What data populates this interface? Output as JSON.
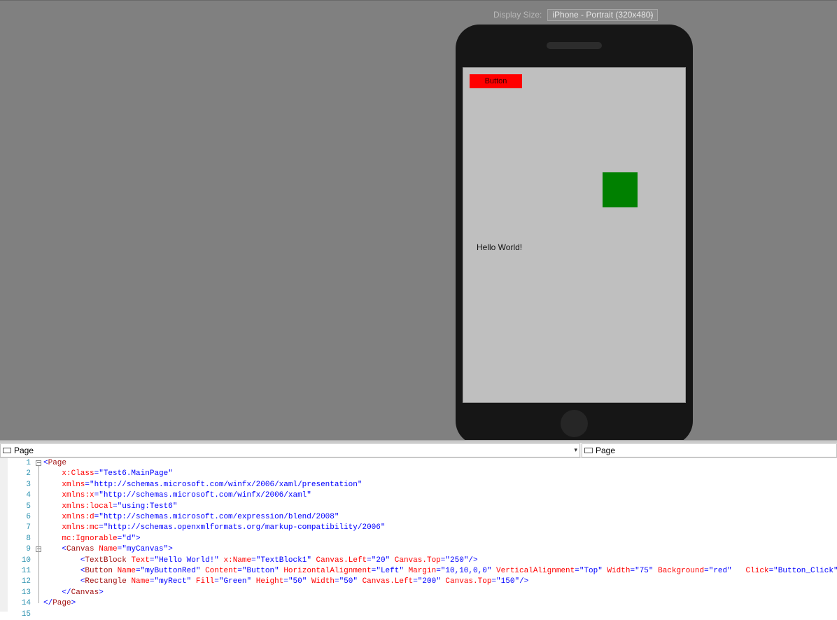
{
  "designer": {
    "display_size_label": "Display Size:",
    "display_size_value": "iPhone - Portrait (320x480)",
    "canvas": {
      "button_label": "Button",
      "button_color": "#ff0000",
      "rect_color": "#008000",
      "textblock_text": "Hello World!"
    }
  },
  "navbar": {
    "left_scope": "Page",
    "right_scope": "Page"
  },
  "editor": {
    "lines": [
      {
        "n": "1",
        "tokens": [
          {
            "t": "<",
            "c": "punct"
          },
          {
            "t": "Page",
            "c": "tag"
          }
        ],
        "indent": 0,
        "fold": "minus"
      },
      {
        "n": "2",
        "tokens": [
          {
            "t": "x:Class",
            "c": "attr"
          },
          {
            "t": "=\"",
            "c": "punct"
          },
          {
            "t": "Test6.MainPage",
            "c": "val"
          },
          {
            "t": "\"",
            "c": "punct"
          }
        ],
        "indent": 4
      },
      {
        "n": "3",
        "tokens": [
          {
            "t": "xmlns",
            "c": "attr"
          },
          {
            "t": "=\"",
            "c": "punct"
          },
          {
            "t": "http://schemas.microsoft.com/winfx/2006/xaml/presentation",
            "c": "val"
          },
          {
            "t": "\"",
            "c": "punct"
          }
        ],
        "indent": 4
      },
      {
        "n": "4",
        "tokens": [
          {
            "t": "xmlns:x",
            "c": "attr"
          },
          {
            "t": "=\"",
            "c": "punct"
          },
          {
            "t": "http://schemas.microsoft.com/winfx/2006/xaml",
            "c": "val"
          },
          {
            "t": "\"",
            "c": "punct"
          }
        ],
        "indent": 4
      },
      {
        "n": "5",
        "tokens": [
          {
            "t": "xmlns:local",
            "c": "attr"
          },
          {
            "t": "=\"",
            "c": "punct"
          },
          {
            "t": "using:Test6",
            "c": "val"
          },
          {
            "t": "\"",
            "c": "punct"
          }
        ],
        "indent": 4
      },
      {
        "n": "6",
        "tokens": [
          {
            "t": "xmlns:d",
            "c": "attr"
          },
          {
            "t": "=\"",
            "c": "punct"
          },
          {
            "t": "http://schemas.microsoft.com/expression/blend/2008",
            "c": "val"
          },
          {
            "t": "\"",
            "c": "punct"
          }
        ],
        "indent": 4
      },
      {
        "n": "7",
        "tokens": [
          {
            "t": "xmlns:mc",
            "c": "attr"
          },
          {
            "t": "=\"",
            "c": "punct"
          },
          {
            "t": "http://schemas.openxmlformats.org/markup-compatibility/2006",
            "c": "val"
          },
          {
            "t": "\"",
            "c": "punct"
          }
        ],
        "indent": 4
      },
      {
        "n": "8",
        "tokens": [
          {
            "t": "mc:Ignorable",
            "c": "attr"
          },
          {
            "t": "=\"",
            "c": "punct"
          },
          {
            "t": "d",
            "c": "val"
          },
          {
            "t": "\">",
            "c": "punct"
          }
        ],
        "indent": 4
      },
      {
        "n": "9",
        "tokens": [
          {
            "t": "<",
            "c": "punct"
          },
          {
            "t": "Canvas",
            "c": "tag"
          },
          {
            "t": " Name",
            "c": "attr"
          },
          {
            "t": "=\"",
            "c": "punct"
          },
          {
            "t": "myCanvas",
            "c": "val"
          },
          {
            "t": "\">",
            "c": "punct"
          }
        ],
        "indent": 4,
        "fold": "minus"
      },
      {
        "n": "10",
        "tokens": [
          {
            "t": "<",
            "c": "punct"
          },
          {
            "t": "TextBlock",
            "c": "tag"
          },
          {
            "t": " Text",
            "c": "attr"
          },
          {
            "t": "=\"",
            "c": "punct"
          },
          {
            "t": "Hello World!",
            "c": "val"
          },
          {
            "t": "\"",
            "c": "punct"
          },
          {
            "t": " x:Name",
            "c": "attr"
          },
          {
            "t": "=\"",
            "c": "punct"
          },
          {
            "t": "TextBlock1",
            "c": "val"
          },
          {
            "t": "\"",
            "c": "punct"
          },
          {
            "t": " Canvas.Left",
            "c": "attr"
          },
          {
            "t": "=\"",
            "c": "punct"
          },
          {
            "t": "20",
            "c": "val"
          },
          {
            "t": "\"",
            "c": "punct"
          },
          {
            "t": " Canvas.Top",
            "c": "attr"
          },
          {
            "t": "=\"",
            "c": "punct"
          },
          {
            "t": "250",
            "c": "val"
          },
          {
            "t": "\"/>",
            "c": "punct"
          }
        ],
        "indent": 8
      },
      {
        "n": "11",
        "tokens": [
          {
            "t": "<",
            "c": "punct"
          },
          {
            "t": "Button",
            "c": "tag"
          },
          {
            "t": " Name",
            "c": "attr"
          },
          {
            "t": "=\"",
            "c": "punct"
          },
          {
            "t": "myButtonRed",
            "c": "val"
          },
          {
            "t": "\"",
            "c": "punct"
          },
          {
            "t": " Content",
            "c": "attr"
          },
          {
            "t": "=\"",
            "c": "punct"
          },
          {
            "t": "Button",
            "c": "val"
          },
          {
            "t": "\"",
            "c": "punct"
          },
          {
            "t": " HorizontalAlignment",
            "c": "attr"
          },
          {
            "t": "=\"",
            "c": "punct"
          },
          {
            "t": "Left",
            "c": "val"
          },
          {
            "t": "\"",
            "c": "punct"
          },
          {
            "t": " Margin",
            "c": "attr"
          },
          {
            "t": "=\"",
            "c": "punct"
          },
          {
            "t": "10,10,0,0",
            "c": "val"
          },
          {
            "t": "\"",
            "c": "punct"
          },
          {
            "t": " VerticalAlignment",
            "c": "attr"
          },
          {
            "t": "=\"",
            "c": "punct"
          },
          {
            "t": "Top",
            "c": "val"
          },
          {
            "t": "\"",
            "c": "punct"
          },
          {
            "t": " Width",
            "c": "attr"
          },
          {
            "t": "=\"",
            "c": "punct"
          },
          {
            "t": "75",
            "c": "val"
          },
          {
            "t": "\"",
            "c": "punct"
          },
          {
            "t": " Background",
            "c": "attr"
          },
          {
            "t": "=\"",
            "c": "punct"
          },
          {
            "t": "red",
            "c": "val"
          },
          {
            "t": "\"",
            "c": "punct"
          },
          {
            "t": "   Click",
            "c": "attr"
          },
          {
            "t": "=\"",
            "c": "punct"
          },
          {
            "t": "Button_Click",
            "c": "val"
          },
          {
            "t": "\"/>",
            "c": "punct"
          }
        ],
        "indent": 8
      },
      {
        "n": "12",
        "tokens": [
          {
            "t": "<",
            "c": "punct"
          },
          {
            "t": "Rectangle",
            "c": "tag"
          },
          {
            "t": " Name",
            "c": "attr"
          },
          {
            "t": "=\"",
            "c": "punct"
          },
          {
            "t": "myRect",
            "c": "val"
          },
          {
            "t": "\"",
            "c": "punct"
          },
          {
            "t": " Fill",
            "c": "attr"
          },
          {
            "t": "=\"",
            "c": "punct"
          },
          {
            "t": "Green",
            "c": "val"
          },
          {
            "t": "\"",
            "c": "punct"
          },
          {
            "t": " Height",
            "c": "attr"
          },
          {
            "t": "=\"",
            "c": "punct"
          },
          {
            "t": "50",
            "c": "val"
          },
          {
            "t": "\"",
            "c": "punct"
          },
          {
            "t": " Width",
            "c": "attr"
          },
          {
            "t": "=\"",
            "c": "punct"
          },
          {
            "t": "50",
            "c": "val"
          },
          {
            "t": "\"",
            "c": "punct"
          },
          {
            "t": " Canvas.Left",
            "c": "attr"
          },
          {
            "t": "=\"",
            "c": "punct"
          },
          {
            "t": "200",
            "c": "val"
          },
          {
            "t": "\"",
            "c": "punct"
          },
          {
            "t": " Canvas.Top",
            "c": "attr"
          },
          {
            "t": "=\"",
            "c": "punct"
          },
          {
            "t": "150",
            "c": "val"
          },
          {
            "t": "\"/>",
            "c": "punct"
          }
        ],
        "indent": 8
      },
      {
        "n": "13",
        "tokens": [
          {
            "t": "</",
            "c": "punct"
          },
          {
            "t": "Canvas",
            "c": "tag"
          },
          {
            "t": ">",
            "c": "punct"
          }
        ],
        "indent": 4
      },
      {
        "n": "14",
        "tokens": [
          {
            "t": "</",
            "c": "punct"
          },
          {
            "t": "Page",
            "c": "tag"
          },
          {
            "t": ">",
            "c": "punct"
          }
        ],
        "indent": 0
      },
      {
        "n": "15",
        "tokens": [],
        "indent": 0
      }
    ]
  }
}
